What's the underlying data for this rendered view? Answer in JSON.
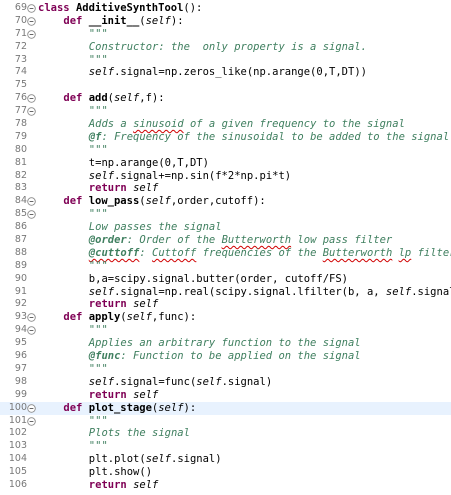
{
  "editor": {
    "colors": {
      "keyword": "#7f0055",
      "docstring": "#3f7f5f",
      "line_number": "#787878",
      "current_line": "#e8f2fe"
    },
    "lines": [
      {
        "n": "69",
        "fold": "minus",
        "indent": 0,
        "parts": [
          [
            "k",
            "class"
          ],
          [
            "t",
            " "
          ],
          [
            "cls",
            "AdditiveSynthTool"
          ],
          [
            "t",
            "():"
          ]
        ]
      },
      {
        "n": "70",
        "fold": "minus",
        "indent": 4,
        "parts": [
          [
            "k",
            "def"
          ],
          [
            "t",
            " "
          ],
          [
            "fn",
            "__init__"
          ],
          [
            "t",
            "("
          ],
          [
            "sf",
            "self"
          ],
          [
            "t",
            "):"
          ]
        ]
      },
      {
        "n": "71",
        "fold": "minus",
        "indent": 8,
        "parts": [
          [
            "doc",
            "\"\"\""
          ]
        ]
      },
      {
        "n": "72",
        "fold": "",
        "indent": 8,
        "parts": [
          [
            "doc",
            "Constructor: the  only property is a signal."
          ]
        ]
      },
      {
        "n": "73",
        "fold": "",
        "indent": 8,
        "parts": [
          [
            "doc",
            "\"\"\""
          ]
        ]
      },
      {
        "n": "74",
        "fold": "",
        "indent": 8,
        "parts": [
          [
            "sf",
            "self"
          ],
          [
            "t",
            ".signal=np.zeros_like(np.arange("
          ],
          [
            "num",
            "0"
          ],
          [
            "t",
            ",T,DT))"
          ]
        ]
      },
      {
        "n": "75",
        "fold": "",
        "indent": 0,
        "parts": []
      },
      {
        "n": "76",
        "fold": "minus",
        "indent": 4,
        "parts": [
          [
            "k",
            "def"
          ],
          [
            "t",
            " "
          ],
          [
            "fn",
            "add"
          ],
          [
            "t",
            "("
          ],
          [
            "sf",
            "self"
          ],
          [
            "t",
            ",f):"
          ]
        ]
      },
      {
        "n": "77",
        "fold": "minus",
        "indent": 8,
        "parts": [
          [
            "doc",
            "\"\"\""
          ]
        ]
      },
      {
        "n": "78",
        "fold": "",
        "indent": 8,
        "parts": [
          [
            "doc",
            "Adds a "
          ],
          [
            "docsq",
            "sinusoid"
          ],
          [
            "doc",
            " of a given frequency to the signal"
          ]
        ]
      },
      {
        "n": "79",
        "fold": "",
        "indent": 8,
        "parts": [
          [
            "tag",
            "@f"
          ],
          [
            "doc",
            ": Frequency of the sinusoidal to be added to the signal"
          ]
        ]
      },
      {
        "n": "80",
        "fold": "",
        "indent": 8,
        "parts": [
          [
            "doc",
            "\"\"\""
          ]
        ]
      },
      {
        "n": "81",
        "fold": "",
        "indent": 8,
        "parts": [
          [
            "t",
            "t=np.arange("
          ],
          [
            "num",
            "0"
          ],
          [
            "t",
            ",T,DT)"
          ]
        ]
      },
      {
        "n": "82",
        "fold": "",
        "indent": 8,
        "parts": [
          [
            "sf",
            "self"
          ],
          [
            "t",
            ".signal+=np.sin(f*"
          ],
          [
            "num",
            "2"
          ],
          [
            "t",
            "*np.pi*t)"
          ]
        ]
      },
      {
        "n": "83",
        "fold": "",
        "indent": 8,
        "parts": [
          [
            "k",
            "return"
          ],
          [
            "t",
            " "
          ],
          [
            "sf",
            "self"
          ]
        ]
      },
      {
        "n": "84",
        "fold": "minus",
        "indent": 4,
        "parts": [
          [
            "k",
            "def"
          ],
          [
            "t",
            " "
          ],
          [
            "fn",
            "low_pass"
          ],
          [
            "t",
            "("
          ],
          [
            "sf",
            "self"
          ],
          [
            "t",
            ",order,cutoff):"
          ]
        ]
      },
      {
        "n": "85",
        "fold": "minus",
        "indent": 8,
        "parts": [
          [
            "doc",
            "\"\"\""
          ]
        ]
      },
      {
        "n": "86",
        "fold": "",
        "indent": 8,
        "parts": [
          [
            "doc",
            "Low passes the signal"
          ]
        ]
      },
      {
        "n": "87",
        "fold": "",
        "indent": 8,
        "parts": [
          [
            "tag",
            "@order"
          ],
          [
            "doc",
            ": Order of the "
          ],
          [
            "docsq",
            "Butterworth"
          ],
          [
            "doc",
            " low pass filter"
          ]
        ]
      },
      {
        "n": "88",
        "fold": "",
        "indent": 8,
        "parts": [
          [
            "tagsq",
            "@cuttoff"
          ],
          [
            "doc",
            ": "
          ],
          [
            "docsq",
            "Cuttoff"
          ],
          [
            "doc",
            " frequencies of the "
          ],
          [
            "docsq",
            "Butterworth"
          ],
          [
            "doc",
            " "
          ],
          [
            "docsq",
            "lp"
          ],
          [
            "doc",
            " filter"
          ]
        ]
      },
      {
        "n": "89",
        "fold": "",
        "indent": 8,
        "parts": [
          [
            "doc",
            "\"\"\""
          ]
        ]
      },
      {
        "n": "90",
        "fold": "",
        "indent": 8,
        "parts": [
          [
            "t",
            "b,a=scipy.signal.butter(order, cutoff/FS)"
          ]
        ]
      },
      {
        "n": "91",
        "fold": "",
        "indent": 8,
        "parts": [
          [
            "sf",
            "self"
          ],
          [
            "t",
            ".signal=np.real(scipy.signal.lfilter(b, a, "
          ],
          [
            "sf",
            "self"
          ],
          [
            "t",
            ".signal))"
          ]
        ]
      },
      {
        "n": "92",
        "fold": "",
        "indent": 8,
        "parts": [
          [
            "k",
            "return"
          ],
          [
            "t",
            " "
          ],
          [
            "sf",
            "self"
          ]
        ]
      },
      {
        "n": "93",
        "fold": "minus",
        "indent": 4,
        "parts": [
          [
            "k",
            "def"
          ],
          [
            "t",
            " "
          ],
          [
            "fn",
            "apply"
          ],
          [
            "t",
            "("
          ],
          [
            "sf",
            "self"
          ],
          [
            "t",
            ",func):"
          ]
        ]
      },
      {
        "n": "94",
        "fold": "minus",
        "indent": 8,
        "parts": [
          [
            "doc",
            "\"\"\""
          ]
        ]
      },
      {
        "n": "95",
        "fold": "",
        "indent": 8,
        "parts": [
          [
            "doc",
            "Applies an arbitrary function to the signal"
          ]
        ]
      },
      {
        "n": "96",
        "fold": "",
        "indent": 8,
        "parts": [
          [
            "tag",
            "@func"
          ],
          [
            "doc",
            ": Function to be applied on the signal"
          ]
        ]
      },
      {
        "n": "97",
        "fold": "",
        "indent": 8,
        "parts": [
          [
            "doc",
            "\"\"\""
          ]
        ]
      },
      {
        "n": "98",
        "fold": "",
        "indent": 8,
        "parts": [
          [
            "sf",
            "self"
          ],
          [
            "t",
            ".signal=func("
          ],
          [
            "sf",
            "self"
          ],
          [
            "t",
            ".signal)"
          ]
        ]
      },
      {
        "n": "99",
        "fold": "",
        "indent": 8,
        "parts": [
          [
            "k",
            "return"
          ],
          [
            "t",
            " "
          ],
          [
            "sf",
            "self"
          ]
        ]
      },
      {
        "n": "100",
        "fold": "minus",
        "indent": 4,
        "current": true,
        "parts": [
          [
            "k",
            "def"
          ],
          [
            "t",
            " "
          ],
          [
            "fn",
            "plot_stage"
          ],
          [
            "t",
            "("
          ],
          [
            "sf",
            "self"
          ],
          [
            "t",
            "):"
          ]
        ]
      },
      {
        "n": "101",
        "fold": "minus",
        "indent": 8,
        "parts": [
          [
            "doc",
            "\"\"\""
          ]
        ]
      },
      {
        "n": "102",
        "fold": "",
        "indent": 8,
        "parts": [
          [
            "doc",
            "Plots the signal"
          ]
        ]
      },
      {
        "n": "103",
        "fold": "",
        "indent": 8,
        "parts": [
          [
            "doc",
            "\"\"\""
          ]
        ]
      },
      {
        "n": "104",
        "fold": "",
        "indent": 8,
        "parts": [
          [
            "t",
            "plt.plot("
          ],
          [
            "sf",
            "self"
          ],
          [
            "t",
            ".signal)"
          ]
        ]
      },
      {
        "n": "105",
        "fold": "",
        "indent": 8,
        "parts": [
          [
            "t",
            "plt.show()"
          ]
        ]
      },
      {
        "n": "106",
        "fold": "",
        "indent": 8,
        "parts": [
          [
            "k",
            "return"
          ],
          [
            "t",
            " "
          ],
          [
            "sf",
            "self"
          ]
        ]
      }
    ]
  }
}
